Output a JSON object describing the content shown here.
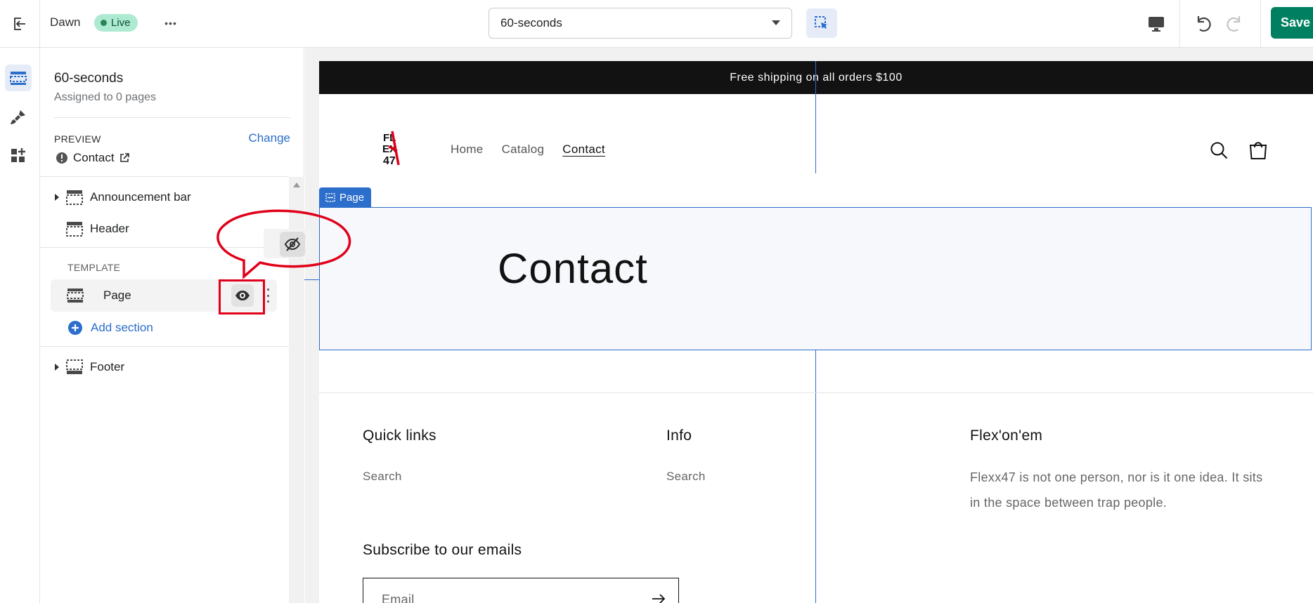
{
  "topbar": {
    "theme_name": "Dawn",
    "live_badge": "Live",
    "more_label": "•••",
    "template_select": "60-seconds",
    "save_label": "Save"
  },
  "sidebar": {
    "template_title": "60-seconds",
    "template_subtitle": "Assigned to 0 pages",
    "preview_label": "PREVIEW",
    "change_label": "Change",
    "preview_page": "Contact",
    "sections": {
      "announcement_bar": "Announcement bar",
      "header": "Header",
      "template_group": "TEMPLATE",
      "page": "Page",
      "add_section": "Add section",
      "footer": "Footer"
    }
  },
  "store": {
    "announcement": "Free shipping on all orders $100",
    "logo_text": "FLEXX47",
    "nav": [
      "Home",
      "Catalog",
      "Contact"
    ],
    "page_tag": "Page",
    "page_heading": "Contact",
    "footer": {
      "quick_links_heading": "Quick links",
      "quick_links_item": "Search",
      "info_heading": "Info",
      "info_item": "Search",
      "brand_heading": "Flex'on'em",
      "brand_text": "Flexx47 is not one person, nor is it one idea. It sits in the space between trap people.",
      "subscribe_heading": "Subscribe to our emails",
      "email_placeholder": "Email"
    }
  },
  "colors": {
    "accent_blue": "#2c6ecb",
    "save_green": "#008060",
    "live_badge_bg": "#aee9d1",
    "annotation_red": "#e1001a",
    "announcement_bg": "#121212"
  }
}
